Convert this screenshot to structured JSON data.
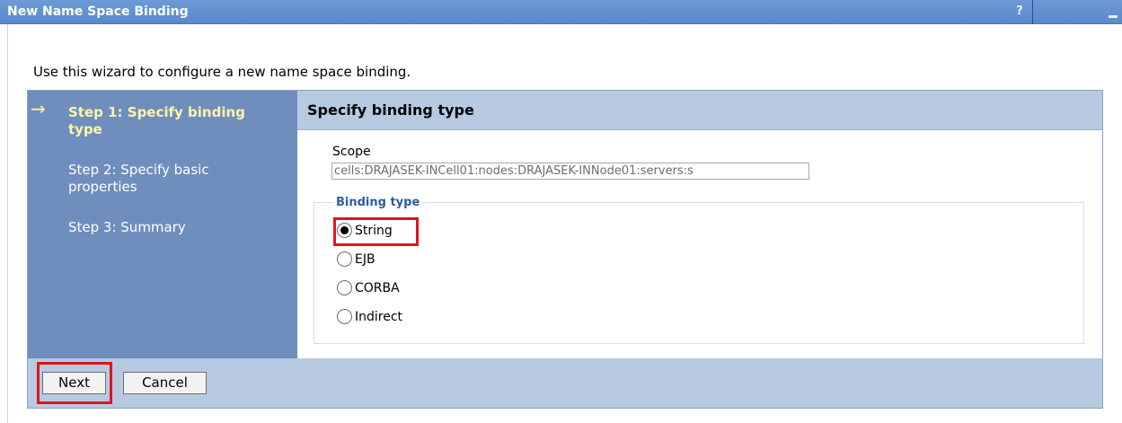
{
  "window": {
    "title": "New Name Space Binding",
    "help_glyph": "?",
    "minimize_icon": "minimize-icon"
  },
  "intro_text": "Use this wizard to configure a new name space binding.",
  "steps": [
    {
      "label": "Step 1: Specify binding type",
      "active": true
    },
    {
      "label": "Step 2: Specify basic properties",
      "active": false
    },
    {
      "label": "Step 3: Summary",
      "active": false
    }
  ],
  "current_step_arrow": "→",
  "panel": {
    "title": "Specify binding type",
    "scope_label": "Scope",
    "scope_value": "cells:DRAJASEK-INCell01:nodes:DRAJASEK-INNode01:servers:s",
    "binding_type_legend": "Binding type",
    "options": [
      {
        "label": "String",
        "checked": true
      },
      {
        "label": "EJB",
        "checked": false
      },
      {
        "label": "CORBA",
        "checked": false
      },
      {
        "label": "Indirect",
        "checked": false
      }
    ]
  },
  "buttons": {
    "next": "Next",
    "cancel": "Cancel"
  },
  "colors": {
    "titlebar": "#5a8acb",
    "steps_panel": "#6f8ebd",
    "active_step": "#fff4a6",
    "highlight": "#e0141b",
    "legend": "#2d5e98"
  }
}
